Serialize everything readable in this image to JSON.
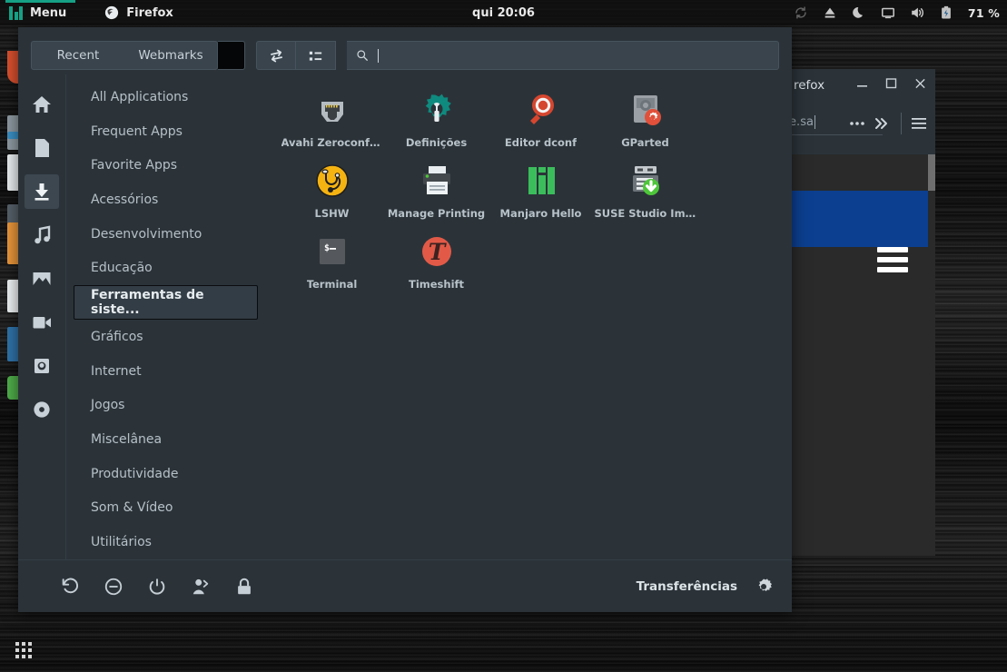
{
  "panel": {
    "menu_label": "Menu",
    "menu_icon": "manjaro-logo-icon",
    "window_button_label": "Firefox",
    "window_button_icon": "firefox-icon",
    "clock": "qui 20:06",
    "tray": [
      {
        "name": "sync-icon",
        "glyph": "sync"
      },
      {
        "name": "eject-icon",
        "glyph": "eject"
      },
      {
        "name": "night-mode-moon-icon",
        "glyph": "moon"
      },
      {
        "name": "display-icon",
        "glyph": "display"
      },
      {
        "name": "volume-icon",
        "glyph": "volume"
      },
      {
        "name": "battery-icon",
        "glyph": "battery"
      }
    ],
    "battery_percent": "71 %"
  },
  "firefox": {
    "title": "refox",
    "minimize_label": "—",
    "maximize_label": "□",
    "close_label": "✕",
    "url_text": "re.sa",
    "page_actions_icon": "ellipsis-icon",
    "overflow_icon": "chevron-double-right-icon",
    "app_menu_icon": "hamburger-menu-icon"
  },
  "menu": {
    "tabs": [
      {
        "label": "Recent",
        "name": "tab-recent"
      },
      {
        "label": "Webmarks",
        "name": "tab-webmarks"
      }
    ],
    "toolbar_buttons": [
      {
        "name": "switch-view-icon",
        "glyph": "swap"
      },
      {
        "name": "list-view-icon",
        "glyph": "list"
      }
    ],
    "search": {
      "icon": "search-icon",
      "value": "",
      "placeholder": ""
    },
    "rail": [
      {
        "name": "rail-home-icon",
        "glyph": "home",
        "active": false
      },
      {
        "name": "rail-documents-icon",
        "glyph": "document",
        "active": false
      },
      {
        "name": "rail-downloads-icon",
        "glyph": "download",
        "active": true
      },
      {
        "name": "rail-music-icon",
        "glyph": "music",
        "active": false
      },
      {
        "name": "rail-pictures-icon",
        "glyph": "image",
        "active": false
      },
      {
        "name": "rail-videos-icon",
        "glyph": "video",
        "active": false
      },
      {
        "name": "rail-camera-icon",
        "glyph": "camera",
        "active": false
      },
      {
        "name": "rail-disc-icon",
        "glyph": "disc",
        "active": false
      }
    ],
    "categories": [
      {
        "label": "All Applications",
        "selected": false
      },
      {
        "label": "Frequent Apps",
        "selected": false
      },
      {
        "label": "Favorite Apps",
        "selected": false
      },
      {
        "label": "Acessórios",
        "selected": false
      },
      {
        "label": "Desenvolvimento",
        "selected": false
      },
      {
        "label": "Educação",
        "selected": false
      },
      {
        "label": "Ferramentas de siste...",
        "selected": true
      },
      {
        "label": "Gráficos",
        "selected": false
      },
      {
        "label": "Internet",
        "selected": false
      },
      {
        "label": "Jogos",
        "selected": false
      },
      {
        "label": "Miscelânea",
        "selected": false
      },
      {
        "label": "Produtividade",
        "selected": false
      },
      {
        "label": "Som & Vídeo",
        "selected": false
      },
      {
        "label": "Utilitários",
        "selected": false
      }
    ],
    "apps": [
      {
        "label": "Avahi Zeroconf B...",
        "icon": "avahi-zeroconf-browser-icon"
      },
      {
        "label": "Definições",
        "icon": "settings-icon"
      },
      {
        "label": "Editor dconf",
        "icon": "dconf-editor-icon"
      },
      {
        "label": "GParted",
        "icon": "gparted-icon"
      },
      {
        "label": "LSHW",
        "icon": "lshw-icon"
      },
      {
        "label": "Manage Printing",
        "icon": "manage-printing-icon"
      },
      {
        "label": "Manjaro Hello",
        "icon": "manjaro-hello-icon"
      },
      {
        "label": "SUSE Studio Ima...",
        "icon": "suse-studio-imagewriter-icon"
      },
      {
        "label": "Terminal",
        "icon": "terminal-icon"
      },
      {
        "label": "Timeshift",
        "icon": "timeshift-icon"
      }
    ],
    "session_buttons": [
      {
        "name": "restart-button",
        "glyph": "restart"
      },
      {
        "name": "suspend-button",
        "glyph": "suspend"
      },
      {
        "name": "shutdown-button",
        "glyph": "power"
      },
      {
        "name": "logout-button",
        "glyph": "logout"
      },
      {
        "name": "lock-screen-button",
        "glyph": "lock"
      }
    ],
    "footer_user": "Transferências",
    "settings_icon": "gear-icon"
  },
  "desktop": {
    "show_desktop_icon": "app-grid-icon"
  },
  "colors": {
    "panel_bg": "#0e0e0e",
    "menu_bg": "#2b3339",
    "accent_teal": "#16a085",
    "selected_bg": "#333d45",
    "text": "#c3ccd2"
  }
}
